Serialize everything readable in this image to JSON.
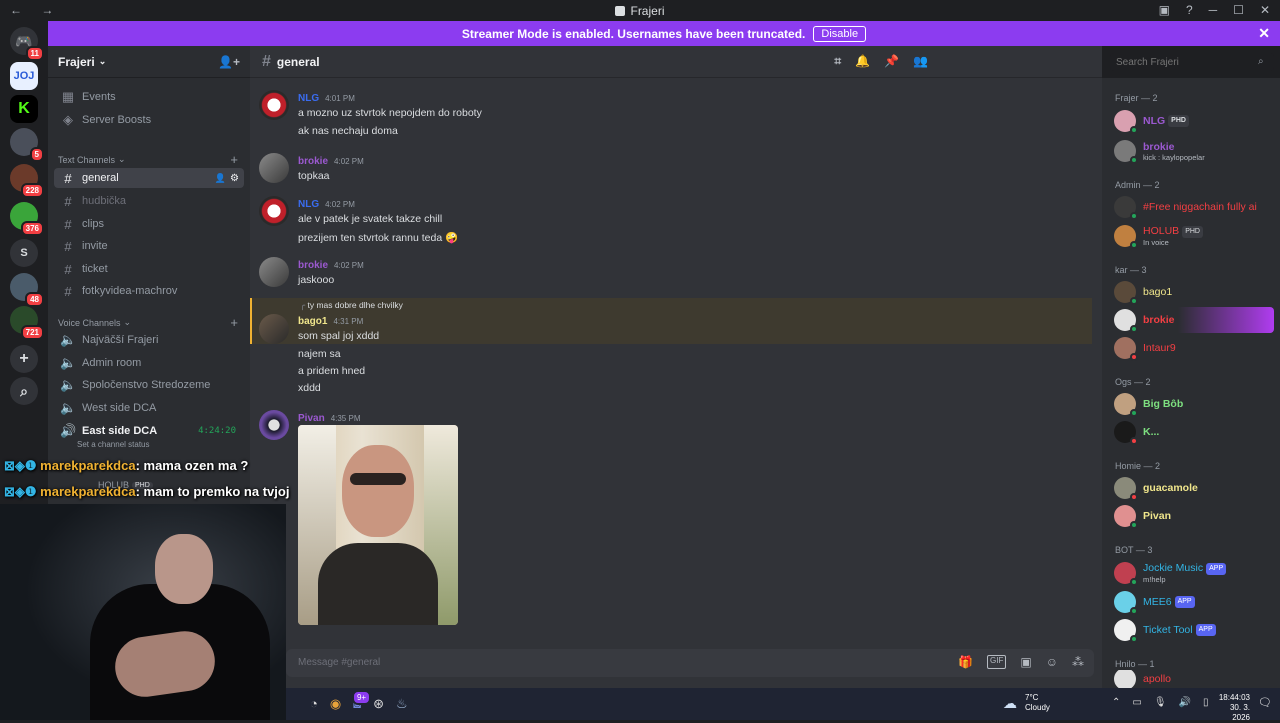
{
  "window": {
    "title": "Frajeri",
    "nav": "← →",
    "controls": [
      "▣",
      "?",
      "─",
      "☐",
      "✕"
    ]
  },
  "banner": {
    "text": "Streamer Mode is enabled. Usernames have been truncated.",
    "disable_label": "Disable",
    "close": "✕"
  },
  "servers": [
    {
      "label": "",
      "badge": "11"
    },
    {
      "label": "JOJ",
      "badge": ""
    },
    {
      "label": "K",
      "badge": ""
    },
    {
      "label": "",
      "badge": "5"
    },
    {
      "label": "",
      "badge": "228"
    },
    {
      "label": "",
      "badge": "376"
    },
    {
      "label": "S",
      "badge": ""
    },
    {
      "label": "",
      "badge": "48"
    },
    {
      "label": "",
      "badge": "721"
    },
    {
      "label": "+",
      "badge": ""
    },
    {
      "label": "⌕",
      "badge": ""
    }
  ],
  "sidebar": {
    "server_name": "Frajeri",
    "top_items": [
      "Events",
      "Server Boosts"
    ],
    "text_category": "Text Channels",
    "text_channels": [
      "general",
      "hudbička",
      "clips",
      "invite",
      "ticket",
      "fotkyvidea-machrov"
    ],
    "voice_category": "Voice Channels",
    "voice_channels": [
      "Najväčší Frajeri",
      "Admin room",
      "Spoločenstvo Stredozeme",
      "West side DCA",
      "East side DCA"
    ],
    "active_voice_timer": "4:24:20",
    "channel_status": "Set a channel status",
    "voice_user": "HOLUB",
    "voice_user_tag": "PHD"
  },
  "main": {
    "channel": "general",
    "search_placeholder": "Search Frajeri",
    "composer_placeholder": "Message #general",
    "messages": [
      {
        "user": "NLG",
        "time": "4:01 PM",
        "lines": [
          "a mozno uz stvrtok nepojdem do roboty",
          "ak nas nechaju doma"
        ]
      },
      {
        "user": "brokie",
        "time": "4:02 PM",
        "lines": [
          "topkaa"
        ]
      },
      {
        "user": "NLG",
        "time": "4:02 PM",
        "lines": [
          "ale v patek je svatek takze chill",
          "prezijem ten stvrtok rannu teda 🤪"
        ]
      },
      {
        "user": "brokie",
        "time": "4:02 PM",
        "lines": [
          "jaskooo"
        ]
      },
      {
        "reply": "ty mas dobre dlhe chvilky",
        "user": "bago1",
        "time": "4:31 PM",
        "lines": [
          "som spal joj xddd",
          "najem sa",
          "a pridem hned",
          "xddd"
        ]
      },
      {
        "user": "Pivan",
        "time": "4:35 PM",
        "lines": []
      }
    ]
  },
  "members": {
    "groups": [
      {
        "name": "Frajer — 2",
        "items": [
          {
            "name": "NLG",
            "tag": "PHD",
            "sub": ""
          },
          {
            "name": "brokie",
            "tag": "",
            "sub": "kick : kaylopopelar"
          }
        ]
      },
      {
        "name": "Admin — 2",
        "items": [
          {
            "name": "#Free niggachain fully ai",
            "tag": "",
            "sub": ""
          },
          {
            "name": "HOLUB",
            "tag": "PHD",
            "sub": "In voice"
          }
        ]
      },
      {
        "name": "kar — 3",
        "items": [
          {
            "name": "bago1",
            "tag": "",
            "sub": ""
          },
          {
            "name": "brokie",
            "tag": "",
            "sub": ""
          },
          {
            "name": "Intaur9",
            "tag": "",
            "sub": ""
          }
        ]
      },
      {
        "name": "Ogs — 2",
        "items": [
          {
            "name": "Big Bôb",
            "tag": "",
            "sub": ""
          },
          {
            "name": "K...",
            "tag": "",
            "sub": ""
          }
        ]
      },
      {
        "name": "Homie — 2",
        "items": [
          {
            "name": "guacamole",
            "tag": "",
            "sub": ""
          },
          {
            "name": "Pivan",
            "tag": "",
            "sub": ""
          }
        ]
      },
      {
        "name": "BOT — 3",
        "items": [
          {
            "name": "Jockie Music",
            "tag": "APP",
            "sub": "m!help"
          },
          {
            "name": "MEE6",
            "tag": "APP",
            "sub": ""
          },
          {
            "name": "Ticket Tool",
            "tag": "APP",
            "sub": ""
          }
        ]
      },
      {
        "name": "Hnilo — 1",
        "items": [
          {
            "name": "apollo",
            "tag": "",
            "sub": ""
          }
        ]
      }
    ]
  },
  "overlay": {
    "chat": [
      {
        "user": "marekparekdca",
        "text": ": mama ozen ma ?"
      },
      {
        "user": "marekparekdca",
        "text": ": mam to premko na tvjoj"
      }
    ]
  },
  "taskbar": {
    "weather_temp": "7°C",
    "weather_text": "Cloudy",
    "time": "18:44:03",
    "date": "30. 3. 2026",
    "discord_badge": "9+"
  },
  "colors": {
    "accent": "#5865f2",
    "banner": "#8c3cf0",
    "online": "#23a55a",
    "dnd": "#f23f43",
    "bg": "#313338",
    "sidebar": "#2b2d31"
  }
}
